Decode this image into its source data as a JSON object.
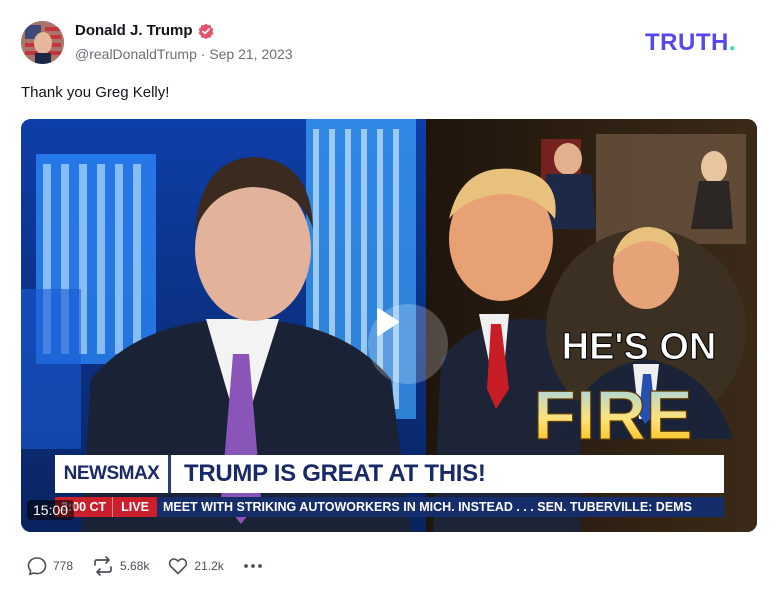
{
  "author": {
    "name": "Donald J. Trump",
    "handle": "@realDonaldTrump",
    "date": "Sep 21, 2023",
    "meta_separator": "·",
    "verified": true
  },
  "brand": {
    "wordmark": "TRUTH",
    "dot": ".",
    "color": "#5448ee",
    "dot_color": "#17e0b6"
  },
  "post": {
    "text": "Thank you Greg Kelly!"
  },
  "video": {
    "duration": "15:00",
    "network_logo": "NEWSMAX",
    "headline": "TRUMP IS GREAT AT THIS!",
    "ticker_time": "3:00 CT",
    "ticker_live": "LIVE",
    "ticker_crawl": "MEET WITH STRIKING AUTOWORKERS IN MICH. INSTEAD . . .    SEN. TUBERVILLE: DEMS",
    "overlay_line1": "HE'S ON",
    "overlay_line2": "FIRE"
  },
  "actions": {
    "reply_count": "778",
    "retruth_count": "5.68k",
    "like_count": "21.2k",
    "icons": [
      "reply-icon",
      "retruth-icon",
      "like-icon",
      "more-icon"
    ]
  }
}
